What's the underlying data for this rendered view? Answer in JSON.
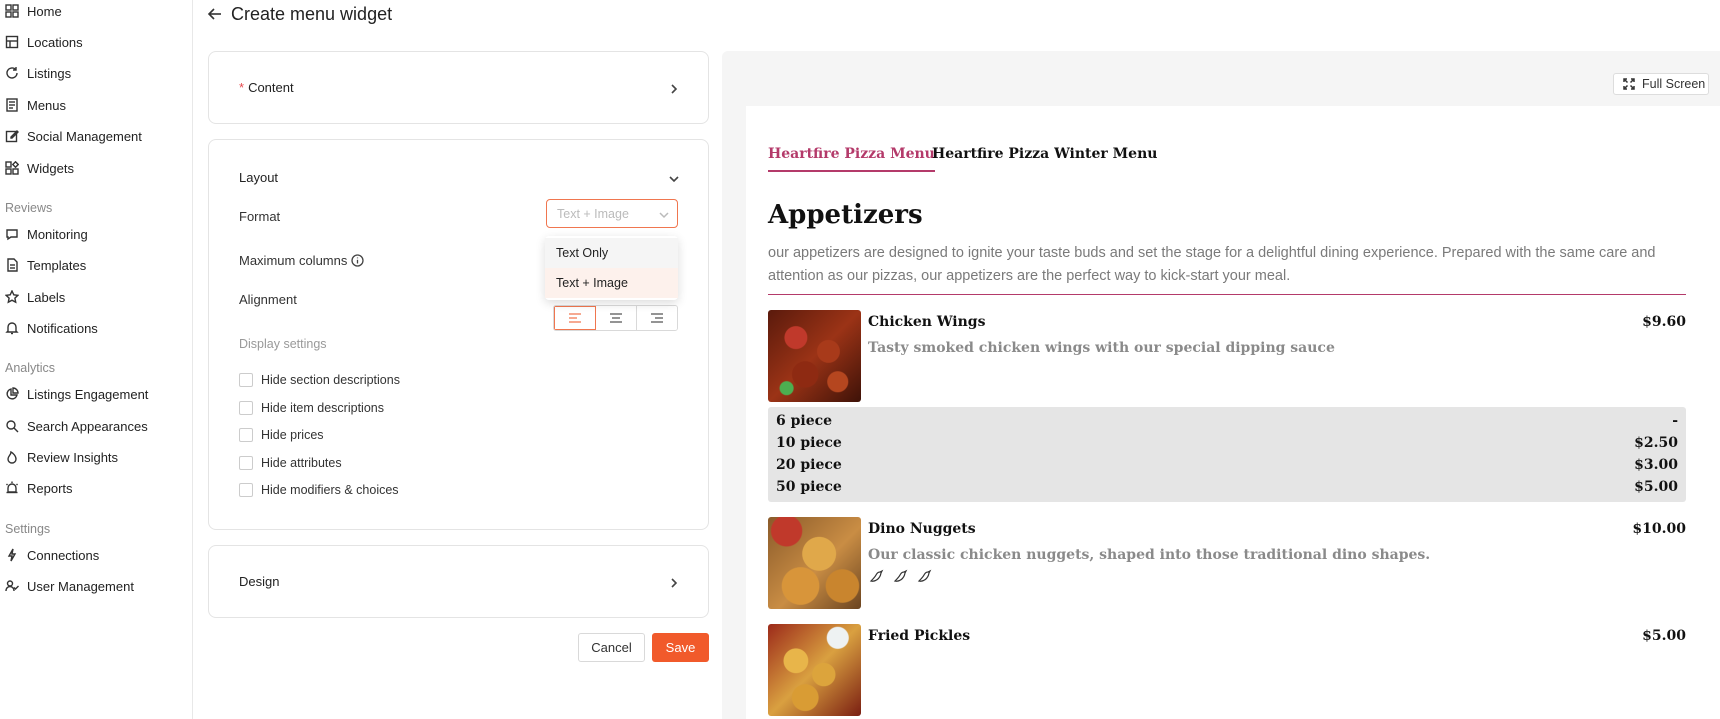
{
  "sidebar": {
    "items_top": [
      {
        "label": "Home",
        "icon": "grid-icon"
      },
      {
        "label": "Locations",
        "icon": "building-icon"
      },
      {
        "label": "Listings",
        "icon": "refresh-icon"
      },
      {
        "label": "Menus",
        "icon": "menu-book-icon"
      },
      {
        "label": "Social Management",
        "icon": "edit-icon"
      },
      {
        "label": "Widgets",
        "icon": "widgets-icon"
      }
    ],
    "reviews_heading": "Reviews",
    "items_reviews": [
      {
        "label": "Monitoring",
        "icon": "chat-icon"
      },
      {
        "label": "Templates",
        "icon": "document-icon"
      },
      {
        "label": "Labels",
        "icon": "star-icon"
      },
      {
        "label": "Notifications",
        "icon": "bell-icon"
      }
    ],
    "analytics_heading": "Analytics",
    "items_analytics": [
      {
        "label": "Listings Engagement",
        "icon": "pie-chart-icon"
      },
      {
        "label": "Search Appearances",
        "icon": "search-icon"
      },
      {
        "label": "Review Insights",
        "icon": "flame-icon"
      },
      {
        "label": "Reports",
        "icon": "alarm-icon"
      }
    ],
    "settings_heading": "Settings",
    "items_settings": [
      {
        "label": "Connections",
        "icon": "plug-icon"
      },
      {
        "label": "User Management",
        "icon": "users-icon"
      }
    ]
  },
  "header": {
    "title": "Create menu widget"
  },
  "content_card": {
    "label": "Content"
  },
  "layout_card": {
    "label": "Layout",
    "format_label": "Format",
    "format_value": "Text + Image",
    "format_options": [
      "Text Only",
      "Text + Image"
    ],
    "max_columns_label": "Maximum columns",
    "alignment_label": "Alignment",
    "display_settings_label": "Display settings",
    "checkboxes": [
      "Hide section descriptions",
      "Hide item descriptions",
      "Hide prices",
      "Hide attributes",
      "Hide modifiers & choices"
    ]
  },
  "design_card": {
    "label": "Design"
  },
  "actions": {
    "cancel": "Cancel",
    "save": "Save"
  },
  "preview": {
    "fullscreen_label": "Full Screen",
    "tabs": [
      "Heartfire Pizza Menu",
      "Heartfire Pizza Winter Menu"
    ],
    "section": {
      "title": "Appetizers",
      "description": "our appetizers are designed to ignite your taste buds and set the stage for a delightful dining experience. Prepared with the same care and attention as our pizzas, our appetizers are the perfect way to kick-start your meal."
    },
    "items": [
      {
        "name": "Chicken Wings",
        "price": "$9.60",
        "description": "Tasty smoked chicken wings with our special dipping sauce",
        "modifiers": [
          {
            "name": "6 piece",
            "price": "-"
          },
          {
            "name": "10 piece",
            "price": "$2.50"
          },
          {
            "name": "20 piece",
            "price": "$3.00"
          },
          {
            "name": "50 piece",
            "price": "$5.00"
          }
        ]
      },
      {
        "name": "Dino Nuggets",
        "price": "$10.00",
        "description": "Our classic chicken nuggets, shaped into those traditional dino shapes.",
        "attribute_icons": [
          "pepper-icon",
          "pepper-icon",
          "pepper-icon"
        ]
      },
      {
        "name": "Fried Pickles",
        "price": "$5.00"
      }
    ],
    "accent_color": "#b43a6a"
  },
  "colors": {
    "primary": "#f15a2b",
    "select_border": "#f0764f"
  }
}
